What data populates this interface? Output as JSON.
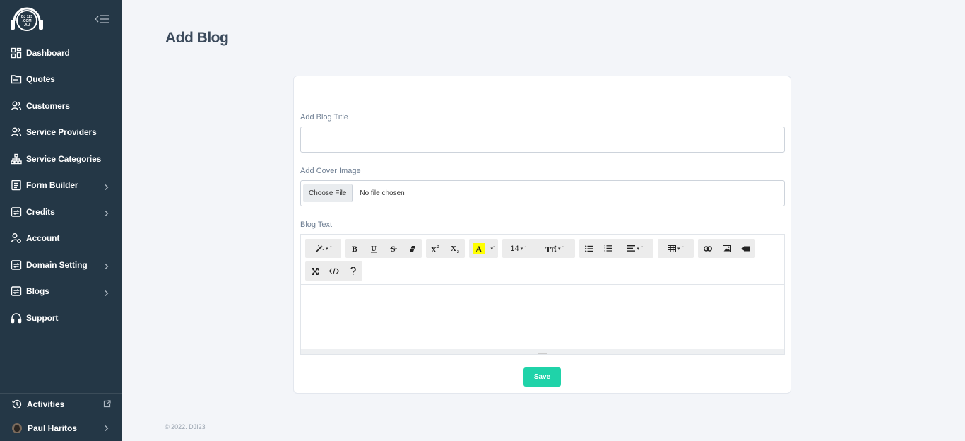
{
  "logo": {
    "line1": "DJ 123",
    "line2": ".COM",
    "line3": ".AU"
  },
  "sidebar": {
    "items": [
      {
        "label": "Dashboard",
        "icon": "dashboard-icon",
        "has_submenu": false
      },
      {
        "label": "Quotes",
        "icon": "folder-icon",
        "has_submenu": false
      },
      {
        "label": "Customers",
        "icon": "users-icon",
        "has_submenu": false
      },
      {
        "label": "Service Providers",
        "icon": "users-icon",
        "has_submenu": false
      },
      {
        "label": "Service Categories",
        "icon": "hierarchy-icon",
        "has_submenu": false
      },
      {
        "label": "Form Builder",
        "icon": "form-icon",
        "has_submenu": true
      },
      {
        "label": "Credits",
        "icon": "transfer-icon",
        "has_submenu": true
      },
      {
        "label": "Account",
        "icon": "user-gear-icon",
        "has_submenu": false
      },
      {
        "label": "Domain Setting",
        "icon": "transfer-icon",
        "has_submenu": true
      },
      {
        "label": "Blogs",
        "icon": "transfer-icon",
        "has_submenu": true
      },
      {
        "label": "Support",
        "icon": "headphones-icon",
        "has_submenu": false
      }
    ],
    "activities_label": "Activities",
    "user_name": "Paul Haritos"
  },
  "page": {
    "title": "Add Blog"
  },
  "form": {
    "title_label": "Add Blog Title",
    "title_value": "",
    "cover_label": "Add Cover Image",
    "choose_file_label": "Choose File",
    "file_status": "No file chosen",
    "text_label": "Blog Text",
    "font_size": "14",
    "editor_content": "",
    "save_label": "Save"
  },
  "footer": {
    "copyright": "© 2022. DJI23"
  },
  "colors": {
    "sidebar_bg": "#243746",
    "accent": "#1fd3a9",
    "page_bg": "#f3f5f9",
    "highlight_color": "#ffff00"
  }
}
